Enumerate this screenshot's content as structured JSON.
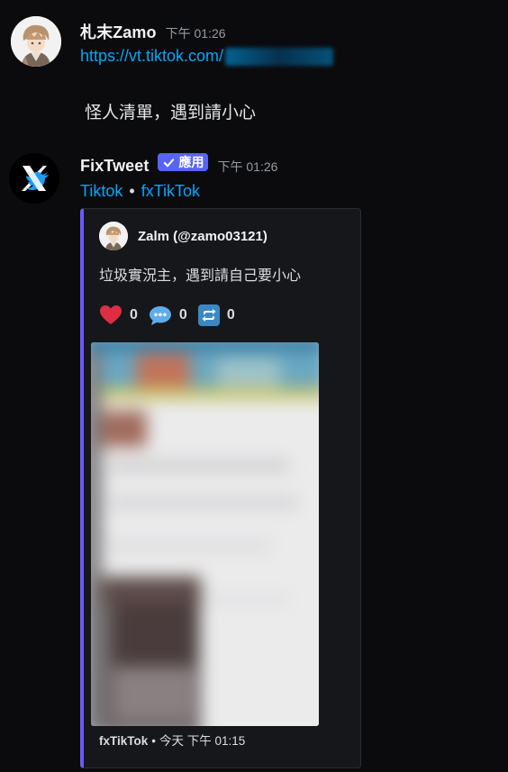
{
  "messages": [
    {
      "username": "札末Zamo",
      "timestamp": "下午 01:26",
      "url_visible": "https://vt.tiktok.com/",
      "text": "怪人清單，遇到請小心"
    },
    {
      "username": "FixTweet",
      "badge": "應用",
      "timestamp": "下午 01:26",
      "links": [
        "Tiktok",
        "fxTikTok"
      ],
      "link_separator": "•",
      "embed": {
        "accent_color": "#6a5af5",
        "author": "Zalm (@zamo03121)",
        "description": "垃圾實況主，遇到請自己要小心",
        "stats": {
          "likes": "0",
          "comments": "0",
          "retweets": "0"
        },
        "footer_name": "fxTikTok",
        "footer_separator": "•",
        "footer_time": "今天 下午 01:15"
      }
    }
  ],
  "icons": {
    "heart": "heart-icon",
    "comment": "speech-bubble-icon",
    "retweet": "retweet-icon",
    "check": "check-icon"
  },
  "colors": {
    "background": "#0b0b0d",
    "link": "#00a8fc",
    "badge": "#5865f2"
  }
}
